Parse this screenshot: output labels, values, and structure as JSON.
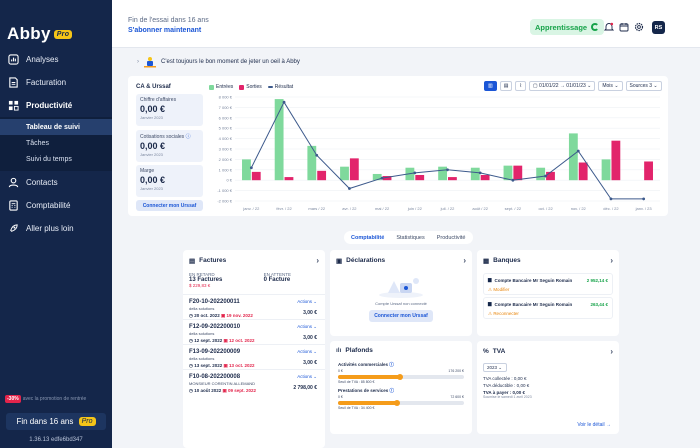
{
  "sidebar": {
    "logo": "Abby",
    "logo_badge": "Pro",
    "items": [
      {
        "label": "Analyses",
        "icon": "analyses-icon"
      },
      {
        "label": "Facturation",
        "icon": "invoice-icon"
      },
      {
        "label": "Productivité",
        "icon": "productivity-icon"
      },
      {
        "label": "Contacts",
        "icon": "contacts-icon"
      },
      {
        "label": "Comptabilité",
        "icon": "accounting-icon"
      },
      {
        "label": "Aller plus loin",
        "icon": "rocket-icon"
      }
    ],
    "sub_items": [
      "Tableau de suivi",
      "Tâches",
      "Suivi du temps"
    ],
    "promo_pct": "-30%",
    "promo_text": "avec la promotion de rentrée",
    "trial_label": "Fin dans 16 ans",
    "trial_badge": "Pro",
    "version": "1.36.13 edfe6bd347"
  },
  "topbar": {
    "trial_text": "Fin de l'essai dans 16 ans",
    "subscribe": "S'abonner maintenant",
    "mode": "Apprentissage",
    "avatar": "RS"
  },
  "welcome": "C'est toujours le bon moment de jeter un oeil à Abby",
  "kpis": {
    "title": "CA & Urssaf",
    "items": [
      {
        "label": "Chiffre d'affaires",
        "value": "0,00 €",
        "date": "Janvier 2023"
      },
      {
        "label": "Cotisations sociales",
        "value": "0,00 €",
        "date": "Janvier 2023"
      },
      {
        "label": "Marge",
        "value": "0,00 €",
        "date": "Janvier 2023"
      }
    ],
    "connect": "Connecter mon Urssaf"
  },
  "chart_controls": {
    "period": "01/01/22 → 01/01/23",
    "granularity": "Mois",
    "sources": "Sources 3"
  },
  "chart_data": {
    "type": "bar",
    "legend": [
      "Entrées",
      "Sorties",
      "Résultat"
    ],
    "colors": {
      "entrees": "#7fd99c",
      "sorties": "#e2246b",
      "resultat": "#3d5a8c"
    },
    "categories": [
      "janv. / 22",
      "févr. / 22",
      "mars / 22",
      "avr. / 22",
      "mai / 22",
      "juin / 22",
      "juil. / 22",
      "août / 22",
      "sept. / 22",
      "oct. / 22",
      "nov. / 22",
      "déc. / 22",
      "janv. / 23"
    ],
    "y_ticks": [
      "8 000 €",
      "7 000 €",
      "6 000 €",
      "5 000 €",
      "4 000 €",
      "3 000 €",
      "2 000 €",
      "1 000 €",
      "0 €",
      "-1 000 €",
      "-2 000 €"
    ],
    "ylim": [
      -2000,
      8000
    ],
    "series": [
      {
        "name": "Entrées",
        "values": [
          2000,
          7800,
          3300,
          1300,
          600,
          1200,
          1300,
          1200,
          1400,
          1200,
          4500,
          2000,
          0
        ]
      },
      {
        "name": "Sorties",
        "values": [
          800,
          300,
          900,
          2100,
          400,
          500,
          300,
          500,
          1400,
          800,
          1700,
          3800,
          1800
        ]
      },
      {
        "name": "Résultat",
        "values": [
          1200,
          7500,
          2400,
          -800,
          200,
          700,
          1000,
          700,
          0,
          400,
          2800,
          -1800,
          -1800
        ]
      }
    ]
  },
  "tabs": [
    "Comptabilité",
    "Statistiques",
    "Productivité"
  ],
  "factures": {
    "title": "Factures",
    "late_label": "EN RETARD",
    "late_value": "13 Factures",
    "late_amount": "$ 229,83 €",
    "wait_label": "EN ATTENTE",
    "wait_value": "0 Facture",
    "items": [
      {
        "no": "F20-10-202200011",
        "client": "della solutions",
        "date": "20 oct. 2022",
        "due": "19 nov. 2022",
        "amount": "3,00 €",
        "action": "Actions"
      },
      {
        "no": "F12-09-202200010",
        "client": "della solutions",
        "date": "12 sept. 2022",
        "due": "12 oct. 2022",
        "amount": "3,00 €",
        "action": "Actions"
      },
      {
        "no": "F13-09-202200009",
        "client": "della solutions",
        "date": "13 sept. 2022",
        "due": "13 oct. 2022",
        "amount": "3,00 €",
        "action": "Actions"
      },
      {
        "no": "F10-08-202200008",
        "client": "MONSIEUR CORENTIN ALLEMAND",
        "date": "10 août 2022",
        "due": "09 sept. 2022",
        "amount": "2 798,00 €",
        "action": "Actions"
      }
    ]
  },
  "declarations": {
    "title": "Déclarations",
    "empty": "Compte Urssaf non connecté",
    "button": "Connecter mon Urssaf"
  },
  "plafonds": {
    "title": "Plafonds",
    "rows": [
      {
        "label": "Activités commerciales",
        "min": "0 €",
        "max": "176 200 €",
        "seuil": "Seuil de TVA : 85 800 €",
        "fill": 0.49
      },
      {
        "label": "Prestations de services",
        "min": "0 €",
        "max": "72 600 €",
        "seuil": "Seuil de TVA : 34 400 €",
        "fill": 0.47
      }
    ]
  },
  "banques": {
    "title": "Banques",
    "items": [
      {
        "name": "Compte Bancaire Mr Seguin Romain",
        "amount": "2 952,14 €",
        "warn": "Modifier"
      },
      {
        "name": "Compte Bancaire Mr Seguin Romain",
        "amount": "263,44 €",
        "warn": "Reconnecter"
      }
    ]
  },
  "tva": {
    "title": "TVA",
    "year": "2023",
    "collectee": "TVA collectée : 0,00 €",
    "deductible": "TVA déductible : 0,00 €",
    "a_payer": "TVA à payer : 0,00 €",
    "sub": "Soumise le samedi 1 avril 2023",
    "more": "Voir le détail →"
  }
}
